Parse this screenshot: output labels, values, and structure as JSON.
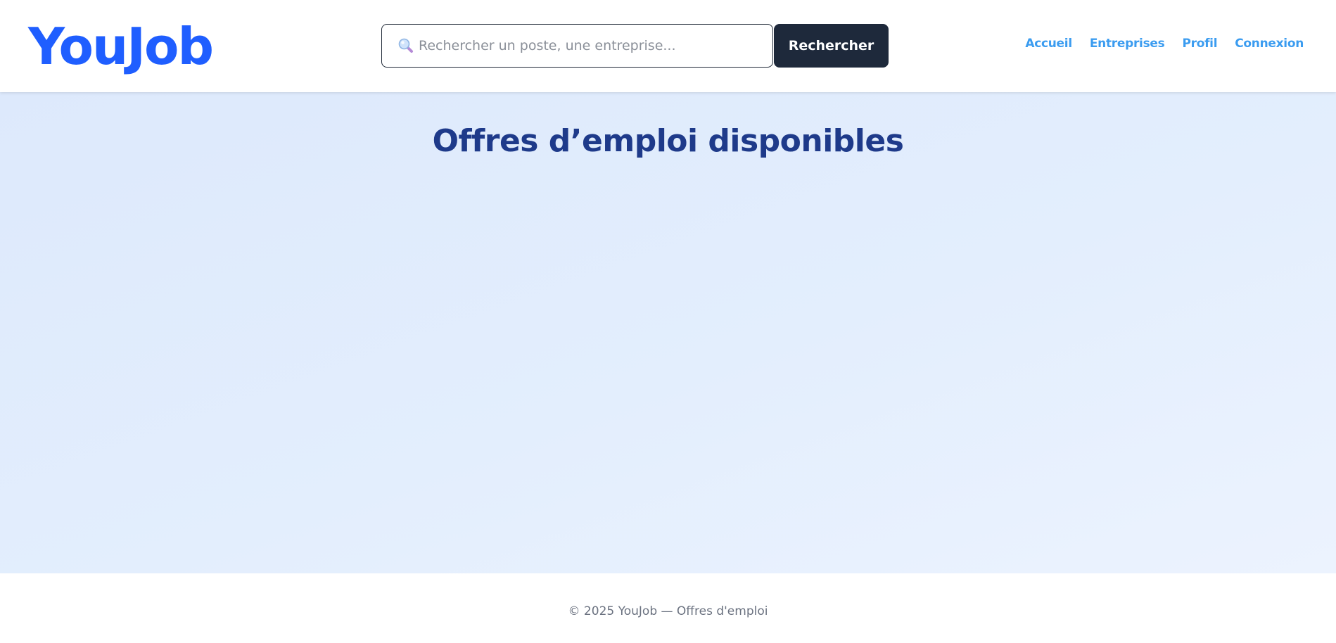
{
  "header": {
    "logo": "YouJob",
    "search": {
      "placeholder": "Rechercher un poste, une entreprise...",
      "value": "",
      "icon": "search-icon",
      "button_label": "Rechercher"
    },
    "nav": [
      {
        "label": "Accueil"
      },
      {
        "label": "Entreprises"
      },
      {
        "label": "Profil"
      },
      {
        "label": "Connexion"
      }
    ]
  },
  "main": {
    "title": "Offres d’emploi disponibles"
  },
  "footer": {
    "text": "© 2025 YouJob — Offres d'emploi"
  },
  "colors": {
    "brand": "#1f5eff",
    "title": "#1e3a8a",
    "nav_link": "#3b9cf0",
    "button_bg": "#1e293b",
    "main_bg": "#dde9fc",
    "footer_text": "#6b7280"
  }
}
